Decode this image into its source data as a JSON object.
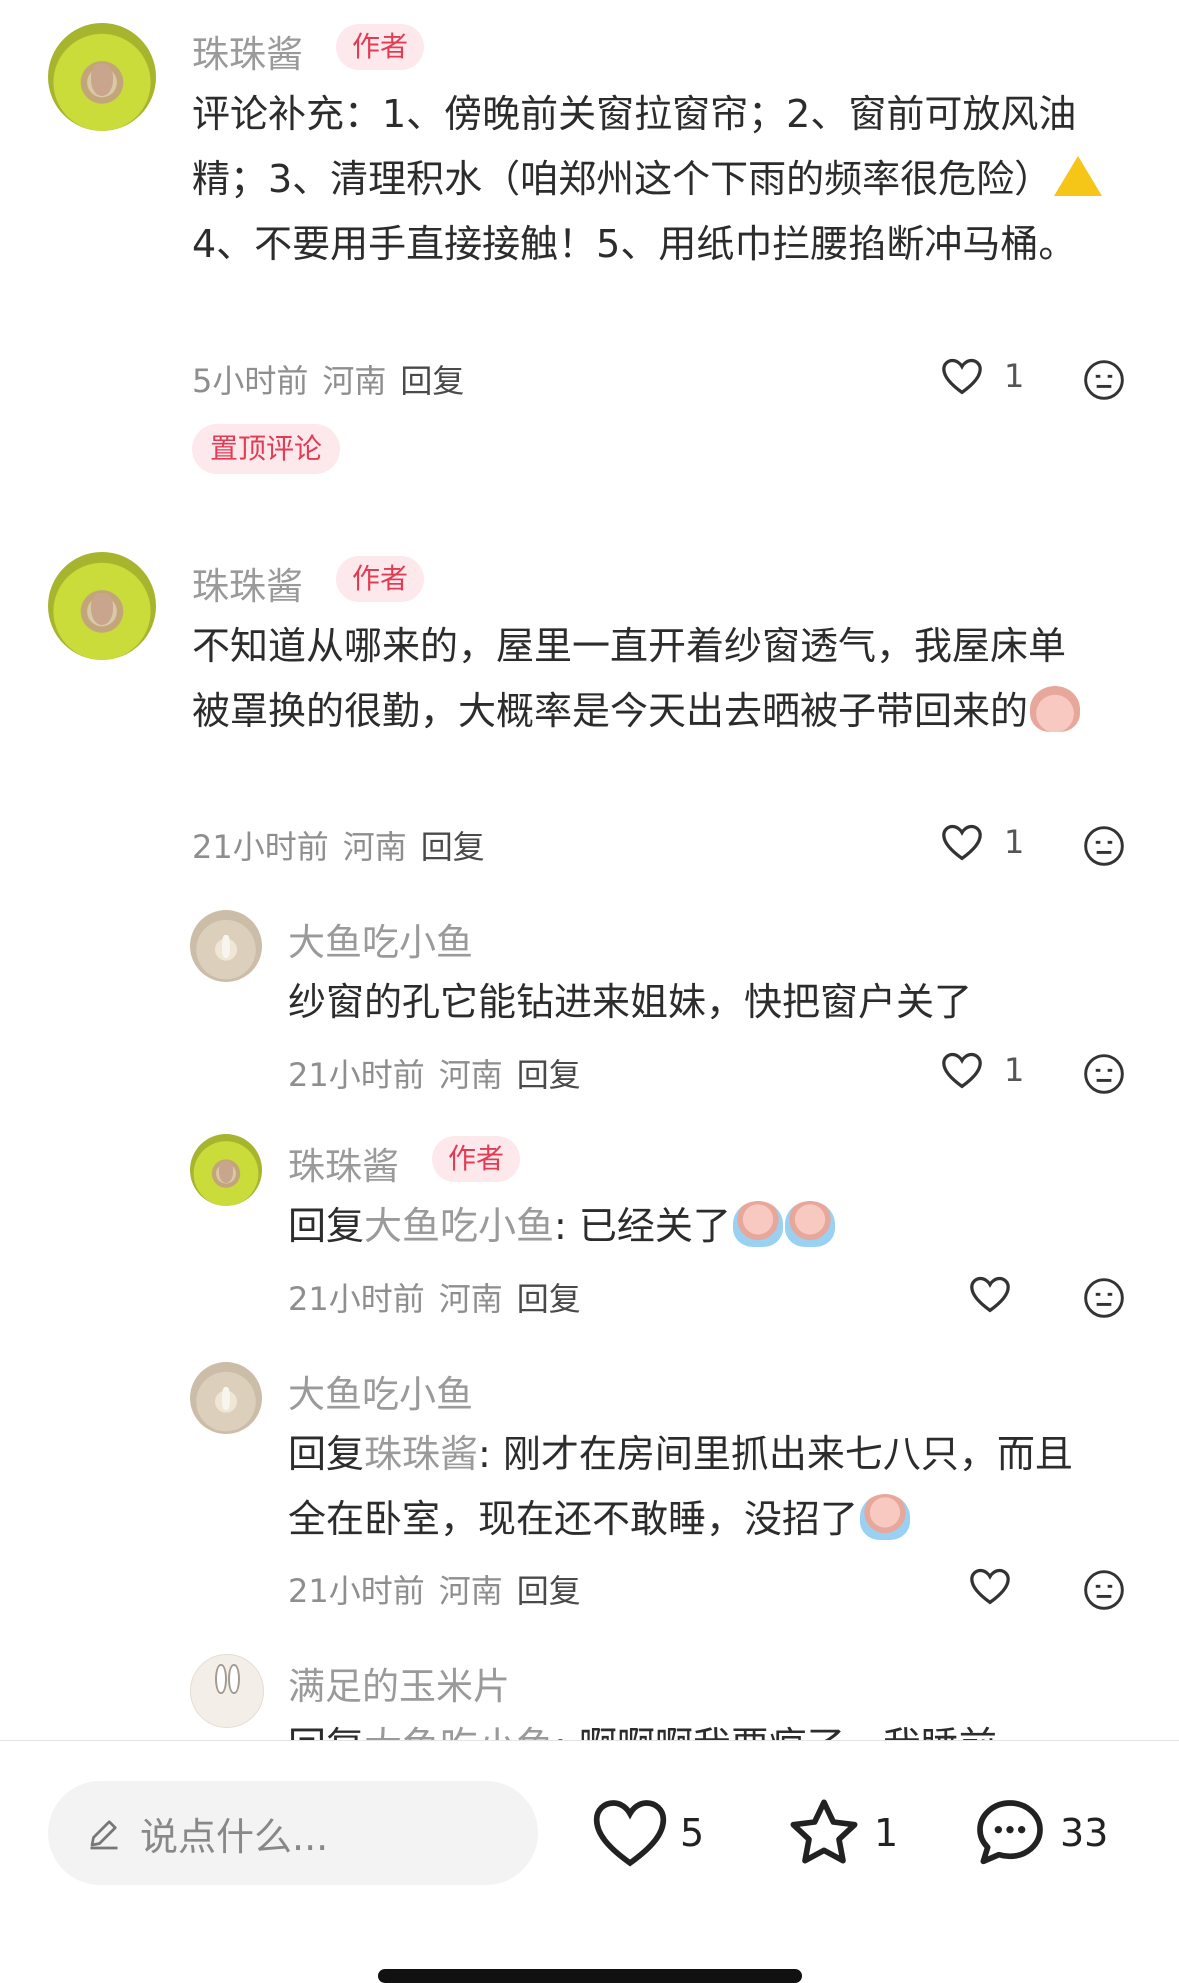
{
  "comments": [
    {
      "author": "珠珠酱",
      "badge": "作者",
      "text": "评论补充：1、傍晚前关窗拉窗帘；2、窗前可放风油精；3、清理积水（咱郑州这个下雨的频率很危险）",
      "text_after_warning": "4、不要用手直接接触！5、用纸巾拦腰掐断冲马桶。",
      "time": "5小时前",
      "location": "河南",
      "reply_label": "回复",
      "likes": "1",
      "pinned_label": "置顶评论"
    },
    {
      "author": "珠珠酱",
      "badge": "作者",
      "text": "不知道从哪来的，屋里一直开着纱窗透气，我屋床单被罩换的很勤，大概率是今天出去晒被子带回来的",
      "time": "21小时前",
      "location": "河南",
      "reply_label": "回复",
      "likes": "1"
    }
  ],
  "replies": [
    {
      "author": "大鱼吃小鱼",
      "text": "纱窗的孔它能钻进来姐妹，快把窗户关了",
      "time": "21小时前",
      "location": "河南",
      "reply_label": "回复",
      "likes": "1"
    },
    {
      "author": "珠珠酱",
      "badge": "作者",
      "prefix": "回复",
      "ref": "大鱼吃小鱼",
      "text": ": 已经关了",
      "time": "21小时前",
      "location": "河南",
      "reply_label": "回复"
    },
    {
      "author": "大鱼吃小鱼",
      "prefix": "回复",
      "ref": "珠珠酱",
      "text": ": 刚才在房间里抓出来七八只，而且全在卧室，现在还不敢睡，没招了",
      "time": "21小时前",
      "location": "河南",
      "reply_label": "回复"
    },
    {
      "author": "满足的玉米片",
      "prefix": "回复",
      "ref": "大鱼吃小鱼",
      "text": ": 啊啊啊我要疯了，我睡前"
    }
  ],
  "bottom_bar": {
    "input_placeholder": "说点什么...",
    "likes": "5",
    "favorites": "1",
    "comments": "33"
  },
  "colors": {
    "accent": "#e23c55",
    "badge_bg": "#fde8ec",
    "muted": "#9a9a9a"
  },
  "icons": [
    "heart-icon",
    "dislike-face-icon",
    "pencil-icon",
    "star-icon",
    "comment-bubble-icon",
    "warning-icon",
    "crying-emoji-icon"
  ]
}
